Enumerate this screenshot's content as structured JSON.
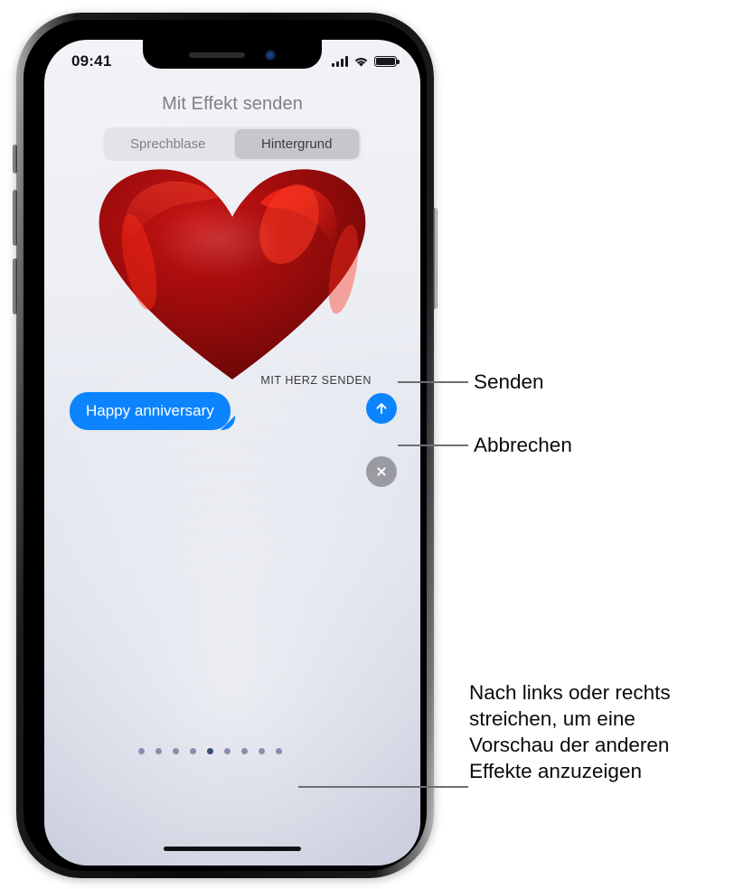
{
  "status_bar": {
    "time": "09:41",
    "signal_icon": "cellular-signal-icon",
    "wifi_icon": "wifi-icon",
    "battery_icon": "battery-full-icon"
  },
  "screen": {
    "title": "Mit Effekt senden",
    "segmented_control": {
      "options": [
        {
          "label": "Sprechblase",
          "selected": false
        },
        {
          "label": "Hintergrund",
          "selected": true
        }
      ]
    },
    "effect_label": "MIT HERZ SENDEN",
    "message_bubble": {
      "text": "Happy anniversary",
      "color": "#0c84fe"
    },
    "send_button": {
      "icon": "arrow-up-icon",
      "color": "#0c84fe"
    },
    "cancel_button": {
      "icon": "close-x-icon",
      "color": "#9a9ba2"
    },
    "page_dots": {
      "count": 9,
      "active_index": 4
    },
    "effect_graphic": "red-heart-balloon"
  },
  "callouts": [
    {
      "label": "Senden"
    },
    {
      "label": "Abbrechen"
    },
    {
      "label": "Nach links oder rechts\nstreichen, um eine\nVorschau der anderen\nEffekte anzuzeigen"
    }
  ],
  "colors": {
    "accent_blue": "#0c84fe",
    "cancel_gray": "#9a9ba2",
    "title_gray": "#7e8086",
    "leader_line": "#6f6f72",
    "dot_active": "#3a4a73",
    "dot_inactive": "#8690ad"
  }
}
